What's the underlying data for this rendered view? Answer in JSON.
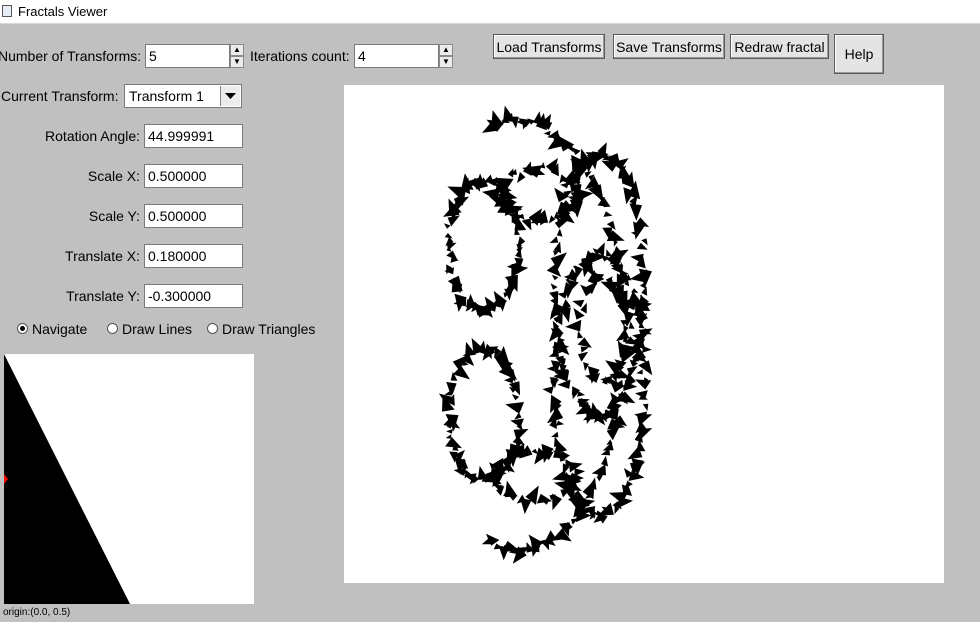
{
  "window": {
    "title": "Fractals Viewer"
  },
  "controls": {
    "num_transforms_label": "Number of Transforms:",
    "num_transforms_value": "5",
    "iterations_label": "Iterations count:",
    "iterations_value": "4",
    "current_transform_label": "Current Transform:",
    "current_transform_value": "Transform 1",
    "rotation_label": "Rotation Angle:",
    "rotation_value": "44.999991",
    "scale_x_label": "Scale X:",
    "scale_x_value": "0.500000",
    "scale_y_label": "Scale Y:",
    "scale_y_value": "0.500000",
    "translate_x_label": "Translate X:",
    "translate_x_value": "0.180000",
    "translate_y_label": "Translate Y:",
    "translate_y_value": "-0.300000"
  },
  "toolbar": {
    "load_label": "Load Transforms",
    "save_label": "Save Transforms",
    "redraw_label": "Redraw fractal",
    "help_label": "Help"
  },
  "modes": {
    "selected": "Navigate",
    "navigate_label": "Navigate",
    "draw_lines_label": "Draw Lines",
    "draw_triangles_label": "Draw Triangles"
  },
  "preview": {
    "origin_text": "origin:(0.0, 0.5)"
  },
  "colors": {
    "marker": "#ff0000",
    "fractal": "#000000",
    "background": "#c0c0c0"
  }
}
